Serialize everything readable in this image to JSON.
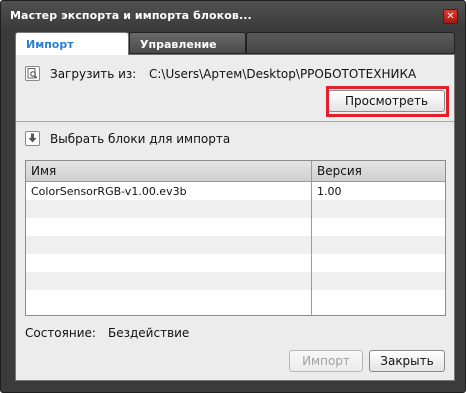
{
  "window": {
    "title": "Мастер экспорта и импорта блоков...",
    "close_glyph": "✕"
  },
  "tabs": [
    {
      "label": "Импорт",
      "active": true
    },
    {
      "label": "Управление",
      "active": false
    }
  ],
  "load": {
    "icon": "load-file-icon",
    "label": "Загрузить из:",
    "path": "C:\\Users\\Артем\\Desktop\\РРОБОТОТЕХНИКА",
    "browse_button": "Просмотреть"
  },
  "select": {
    "icon": "import-arrow-icon",
    "label": "Выбрать блоки для импорта"
  },
  "table": {
    "columns": [
      "Имя",
      "Версия"
    ],
    "rows": [
      {
        "name": "ColorSensorRGB-v1.00.ev3b",
        "version": "1.00"
      }
    ]
  },
  "status": {
    "label": "Состояние:",
    "value": "Бездействие"
  },
  "footer": {
    "import_button": "Импорт",
    "close_button": "Закрыть"
  },
  "colors": {
    "accent_tab": "#2a7fd0",
    "highlight": "#e0202a",
    "window_frame": "#3b3b3b"
  }
}
